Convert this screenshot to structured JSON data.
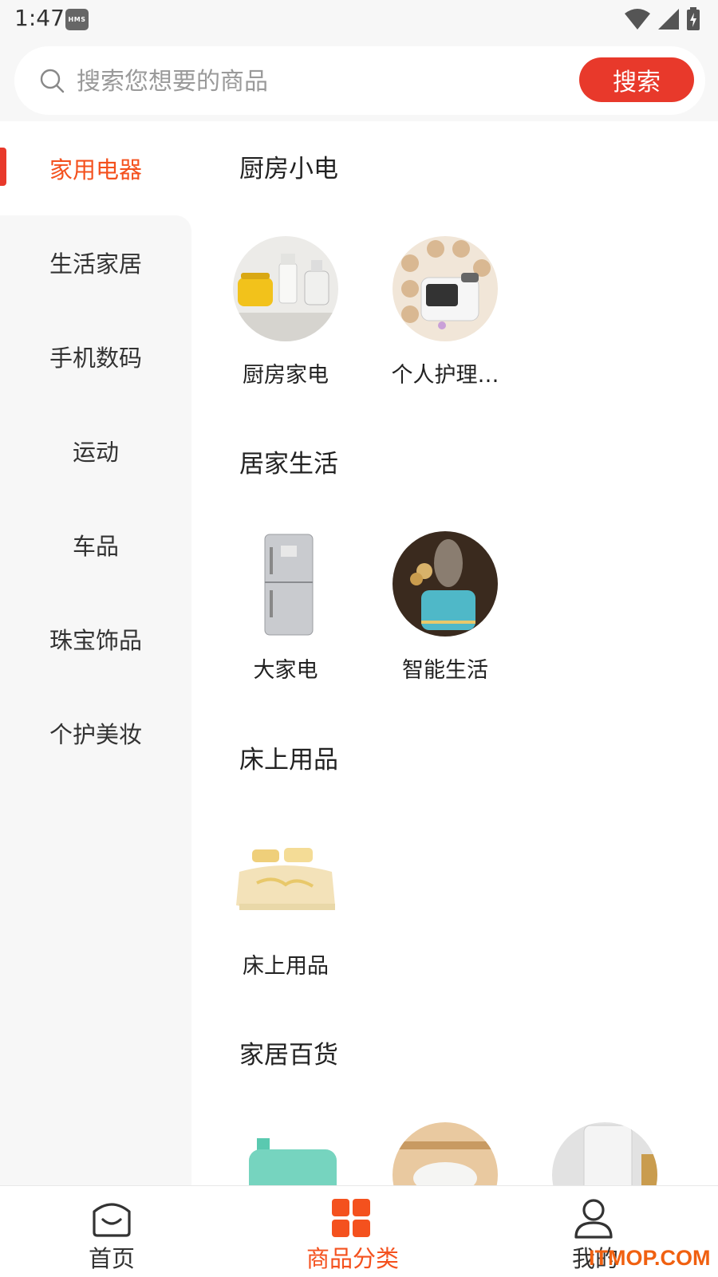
{
  "status_bar": {
    "time": "1:47",
    "badge": "HMS"
  },
  "search": {
    "placeholder": "搜索您想要的商品",
    "button_label": "搜索"
  },
  "sidebar": {
    "items": [
      {
        "label": "家用电器",
        "active": true
      },
      {
        "label": "生活家居"
      },
      {
        "label": "手机数码"
      },
      {
        "label": "运动"
      },
      {
        "label": "车品"
      },
      {
        "label": "珠宝饰品"
      },
      {
        "label": "个护美妆"
      }
    ]
  },
  "sections": [
    {
      "title": "厨房小电",
      "items": [
        {
          "label": "厨房家电"
        },
        {
          "label": "个人护理…"
        }
      ]
    },
    {
      "title": "居家生活",
      "items": [
        {
          "label": "大家电"
        },
        {
          "label": "智能生活"
        }
      ]
    },
    {
      "title": "床上用品",
      "items": [
        {
          "label": "床上用品"
        }
      ]
    },
    {
      "title": "家居百货",
      "items": []
    }
  ],
  "bottom_nav": {
    "items": [
      {
        "label": "首页"
      },
      {
        "label": "商品分类",
        "active": true
      },
      {
        "label": "我的"
      }
    ]
  },
  "watermark": "ITMOP.COM",
  "colors": {
    "accent": "#e8392b",
    "active_text": "#f4511e"
  }
}
